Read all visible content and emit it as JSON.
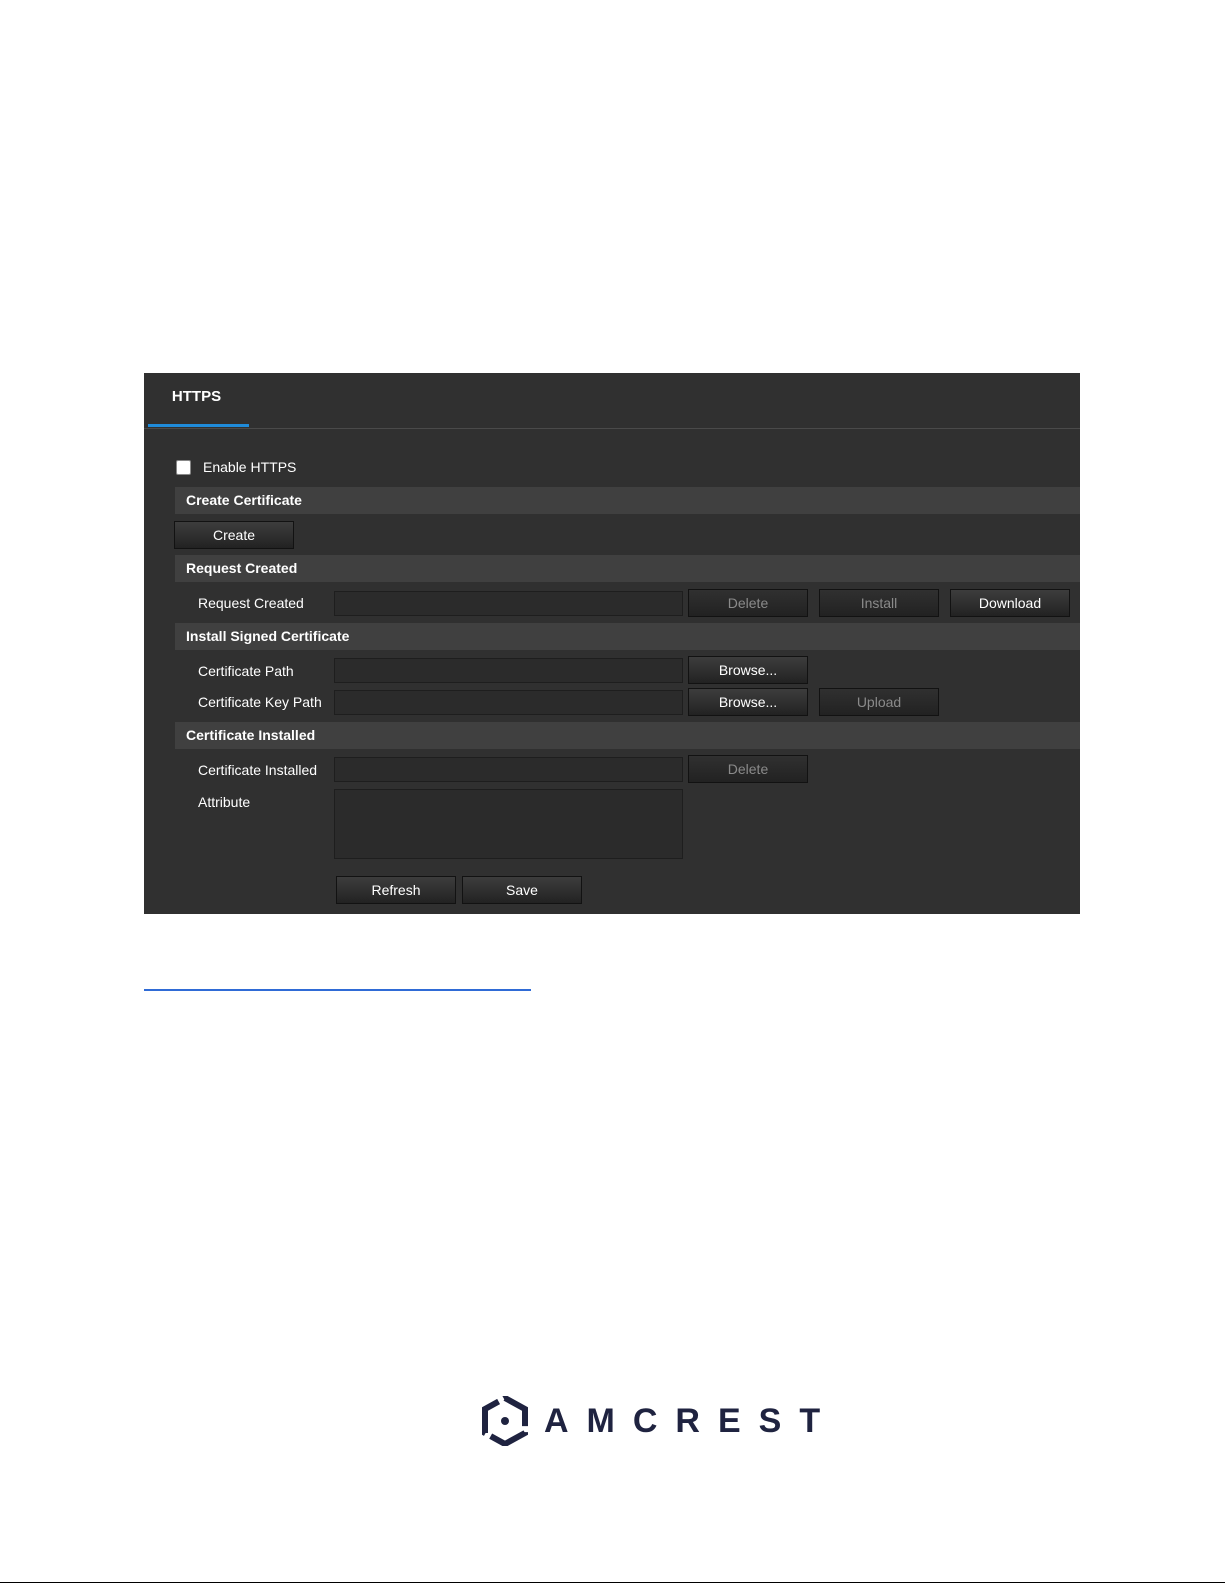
{
  "tab": {
    "label": "HTTPS"
  },
  "enable": {
    "label": "Enable HTTPS",
    "checked": false
  },
  "sections": {
    "create_certificate": "Create Certificate",
    "request_created": "Request Created",
    "install_signed": "Install Signed Certificate",
    "certificate_installed": "Certificate Installed"
  },
  "buttons": {
    "create": "Create",
    "delete": "Delete",
    "install": "Install",
    "download": "Download",
    "browse": "Browse...",
    "upload": "Upload",
    "refresh": "Refresh",
    "save": "Save"
  },
  "labels": {
    "request_created": "Request Created",
    "certificate_path": "Certificate Path",
    "certificate_key_path": "Certificate Key Path",
    "certificate_installed": "Certificate Installed",
    "attribute": "Attribute"
  },
  "fields": {
    "request_created": "",
    "certificate_path": "",
    "certificate_key_path": "",
    "certificate_installed": "",
    "attribute": ""
  },
  "logo": {
    "text": "AMCREST",
    "color": "#1f2340"
  },
  "colors": {
    "accent": "#1f8bd9",
    "panel_bg": "#303030",
    "link": "#2f6bd6"
  }
}
